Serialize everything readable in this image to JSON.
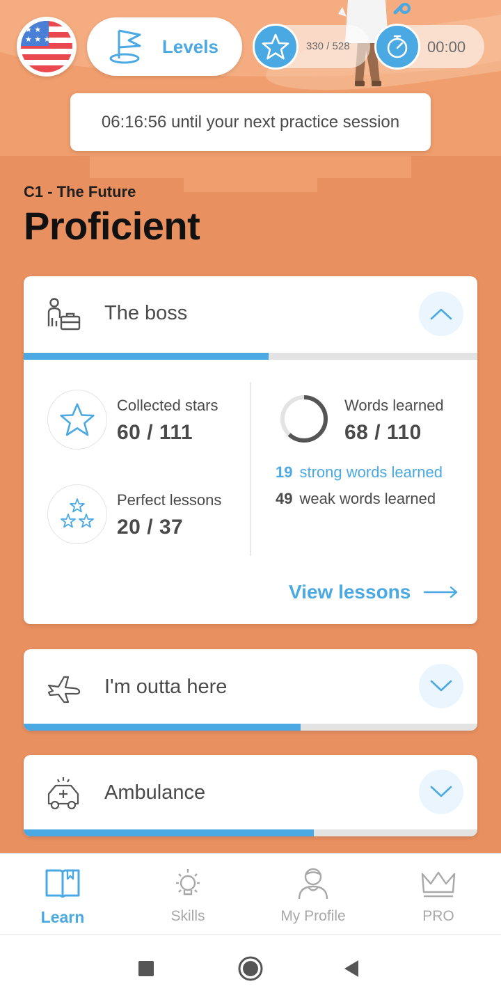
{
  "header": {
    "flag_icon": "us-flag-icon",
    "levels_label": "Levels",
    "stars_count": "330 / 528",
    "timer_value": "00:00",
    "accent_color": "#4AA8E2"
  },
  "toast": {
    "text": "06:16:56 until your next practice session"
  },
  "level": {
    "code": "C1 - The Future",
    "name": "Proficient",
    "background_color": "#E89060"
  },
  "units": [
    {
      "title": "The boss",
      "icon": "businessman-briefcase-icon",
      "expanded": true,
      "progress": 0.54,
      "collected_stars_label": "Collected stars",
      "collected_stars_value": "60 / 111",
      "perfect_lessons_label": "Perfect lessons",
      "perfect_lessons_value": "20 / 37",
      "words_learned_label": "Words learned",
      "words_learned_value": "68 / 110",
      "words_progress": 0.62,
      "strong_count": "19",
      "strong_label": "strong words learned",
      "weak_count": "49",
      "weak_label": "weak words learned",
      "view_lessons_label": "View lessons"
    },
    {
      "title": "I'm outta here",
      "icon": "airplane-icon",
      "expanded": false,
      "progress": 0.61
    },
    {
      "title": "Ambulance",
      "icon": "ambulance-icon",
      "expanded": false,
      "progress": 0.64
    }
  ],
  "bottom_nav": {
    "items": [
      {
        "label": "Learn",
        "icon": "book-icon",
        "active": true
      },
      {
        "label": "Skills",
        "icon": "lightbulb-icon",
        "active": false
      },
      {
        "label": "My Profile",
        "icon": "profile-icon",
        "active": false
      },
      {
        "label": "PRO",
        "icon": "crown-icon",
        "active": false
      }
    ]
  },
  "system_nav": {
    "buttons": [
      "recents-button",
      "home-button",
      "back-button"
    ]
  }
}
